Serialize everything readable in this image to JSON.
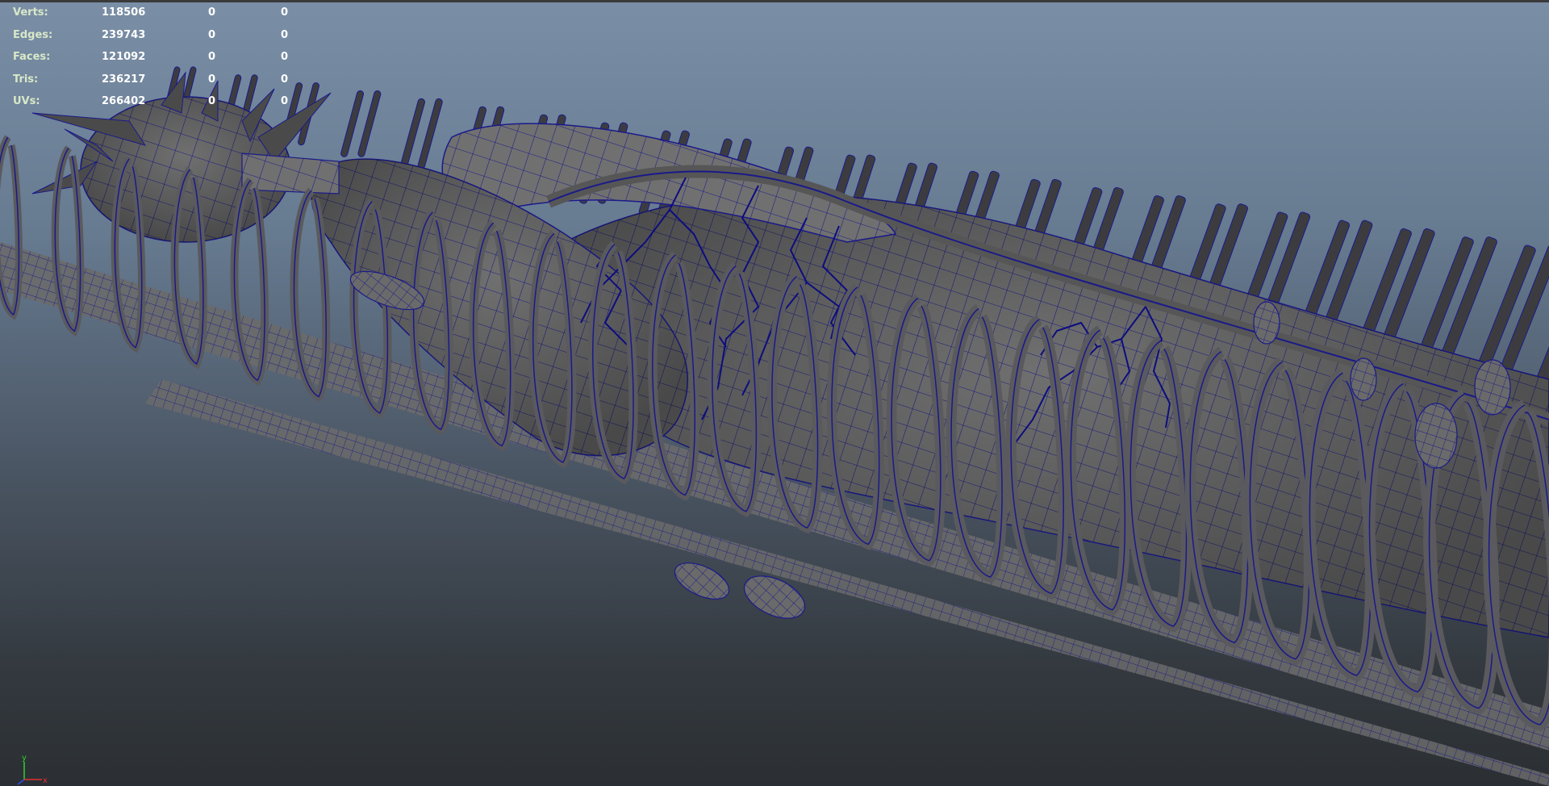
{
  "hud": {
    "rows": [
      {
        "label": "Verts:",
        "values": [
          "118506",
          "0",
          "0"
        ]
      },
      {
        "label": "Edges:",
        "values": [
          "239743",
          "0",
          "0"
        ]
      },
      {
        "label": "Faces:",
        "values": [
          "121092",
          "0",
          "0"
        ]
      },
      {
        "label": "Tris:",
        "values": [
          "236217",
          "0",
          "0"
        ]
      },
      {
        "label": "UVs:",
        "values": [
          "266402",
          "0",
          "0"
        ]
      }
    ]
  },
  "axis_gizmo": {
    "y_label": "y",
    "x_label": "x",
    "y_color": "#30d030",
    "x_color": "#e03030",
    "z_color": "#3050e0"
  },
  "colors": {
    "mesh_fill": "#6e6e6e",
    "wireframe": "#1a1a8a",
    "veins": "#0d0d80"
  },
  "icons": [
    "axis-gizmo-icon"
  ]
}
